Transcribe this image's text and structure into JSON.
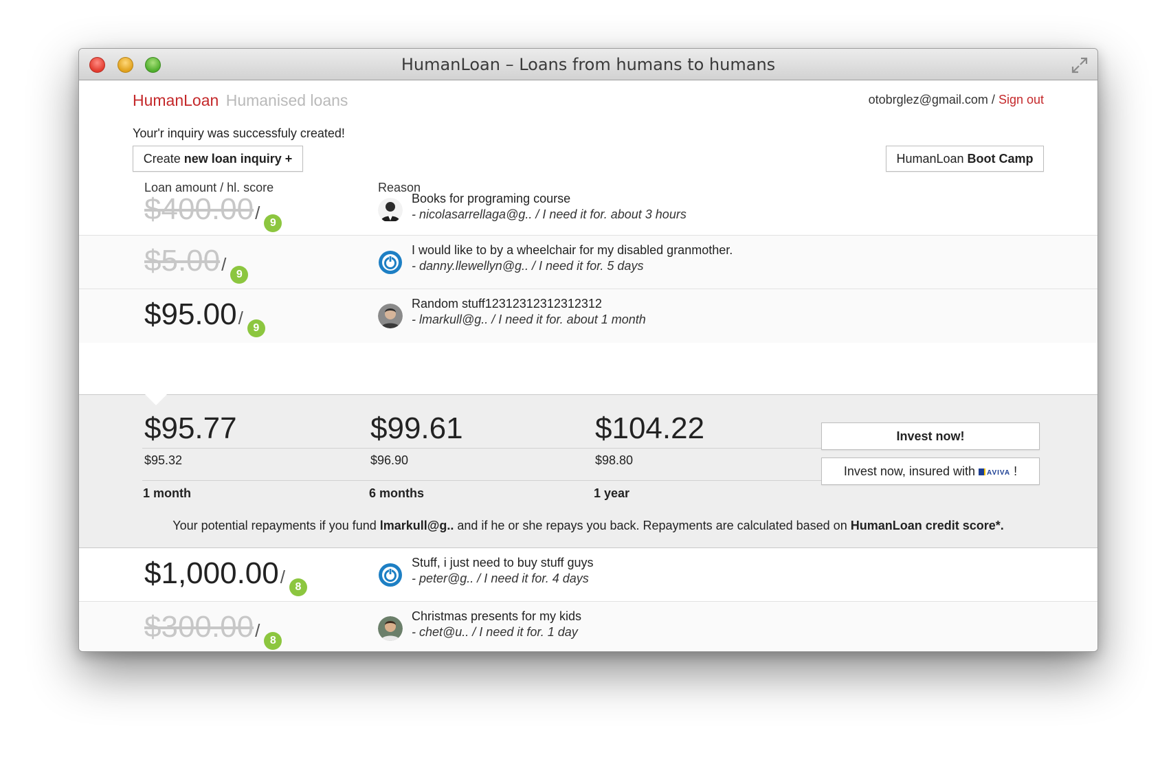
{
  "window": {
    "title": "HumanLoan – Loans from humans to humans"
  },
  "header": {
    "brand_name": "HumanLoan",
    "brand_tagline": "Humanised loans",
    "user_email": "otobrglez@gmail.com",
    "separator": "/",
    "sign_out": "Sign out"
  },
  "flash": {
    "message": "Your'r inquiry was successfuly created!"
  },
  "actions": {
    "new_inquiry_pre": "Create",
    "new_inquiry_bold": "new loan inquiry +",
    "bootcamp_pre": "HumanLoan",
    "bootcamp_bold": "Boot Camp"
  },
  "columns": {
    "amount": "Loan amount / hl. score",
    "reason": "Reason"
  },
  "loans": [
    {
      "amount": "$400.00",
      "slash": "/",
      "score": "9",
      "reason": "Books for programing course",
      "meta": "- nicolasarrellaga@g.. / I need it for. about 3 hours",
      "funded": true,
      "avatar": "person-dark-icon"
    },
    {
      "amount": "$5.00",
      "slash": "/",
      "score": "9",
      "reason": "I would like to by a wheelchair for my disabled granmother.",
      "meta": "- danny.llewellyn@g.. / I need it for. 5 days",
      "funded": true,
      "avatar": "power-icon"
    },
    {
      "amount": "$95.00",
      "slash": "/",
      "score": "9",
      "reason": "Random stuff12312312312312312",
      "meta": "- lmarkull@g.. / I need it for. about 1 month",
      "funded": false,
      "avatar": "person-photo-icon"
    },
    {
      "amount": "$1,000.00",
      "slash": "/",
      "score": "8",
      "reason": "Stuff, i just need to buy stuff guys",
      "meta": "- peter@g.. / I need it for. 4 days",
      "funded": false,
      "avatar": "power-icon"
    },
    {
      "amount": "$300.00",
      "slash": "/",
      "score": "8",
      "reason": "Christmas presents for my kids",
      "meta": "- chet@u.. / I need it for. 1 day",
      "funded": true,
      "avatar": "person-photo-icon"
    }
  ],
  "detail": {
    "options": [
      {
        "total": "$95.77",
        "installment": "$95.32",
        "period": "1 month"
      },
      {
        "total": "$99.61",
        "installment": "$96.90",
        "period": "6 months"
      },
      {
        "total": "$104.22",
        "installment": "$98.80",
        "period": "1 year"
      }
    ],
    "invest_now": "Invest now!",
    "invest_insured_pre": "Invest now, insured with",
    "invest_insured_brand": "AVIVA",
    "invest_insured_post": "!",
    "note_pre": "Your potential repayments if you fund",
    "note_user": "lmarkull@g..",
    "note_mid": "and if he or she repays you back. Repayments are calculated based on",
    "note_bold": "HumanLoan credit score*."
  },
  "colors": {
    "brand": "#c4282a",
    "score_badge": "#8cc63f",
    "panel": "#eeeeee",
    "tagline": "#b9b9b9"
  }
}
